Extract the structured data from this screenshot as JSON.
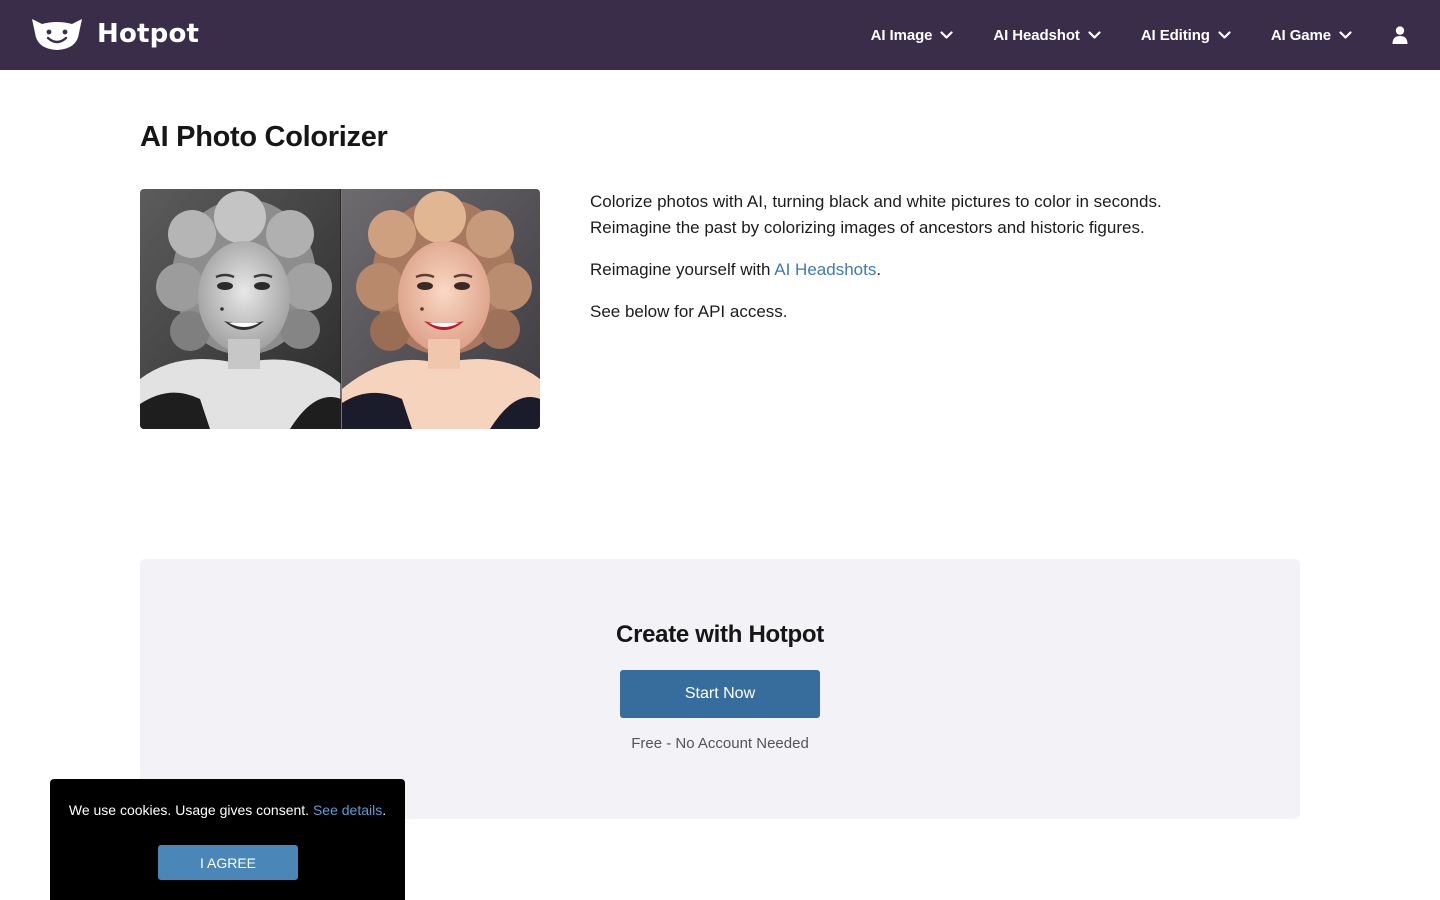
{
  "header": {
    "brand_name": "Hotpot",
    "nav": [
      {
        "label": "AI Image"
      },
      {
        "label": "AI Headshot"
      },
      {
        "label": "AI Editing"
      },
      {
        "label": "AI Game"
      }
    ]
  },
  "main": {
    "title": "AI Photo Colorizer",
    "intro_line1": "Colorize photos with AI, turning black and white pictures to color in seconds.",
    "intro_line2": "Reimagine the past by colorizing images of ancestors and historic figures.",
    "headshot_prefix": "Reimagine yourself with ",
    "headshot_link": "AI Headshots",
    "headshot_suffix": ".",
    "api_note": "See below for API access."
  },
  "create": {
    "title": "Create with Hotpot",
    "button_label": "Start Now",
    "note": "Free - No Account Needed"
  },
  "cookie": {
    "text": "We use cookies. Usage gives consent. ",
    "link": "See details",
    "suffix": ".",
    "button_label": "I AGREE"
  },
  "colors": {
    "navbar": "#3a2d4a",
    "primary_button": "#366d9d",
    "link": "#3d7ab5",
    "panel": "#f3f2f6"
  },
  "icons": {
    "brand": "smiling-face-logo-icon",
    "dropdown": "chevron-down-icon",
    "account": "user-icon"
  }
}
